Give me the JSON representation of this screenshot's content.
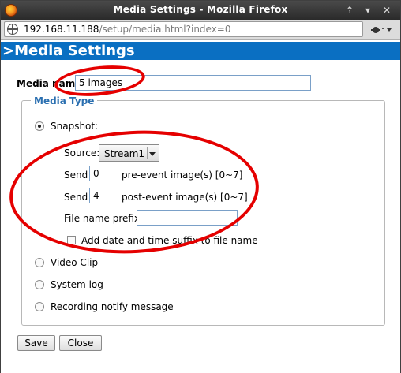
{
  "window": {
    "title": "Media Settings - Mozilla Firefox",
    "controls": {
      "pin": "⇡",
      "minimize": "▾",
      "close": "✕"
    }
  },
  "urlbar": {
    "host": "192.168.11.188",
    "path": "/setup/media.html?index=0"
  },
  "page": {
    "header": ">Media Settings",
    "media_name": {
      "label": "Media name:",
      "value": "5 images"
    },
    "media_type": {
      "legend": "Media Type",
      "options": {
        "snapshot": "Snapshot:",
        "video_clip": "Video Clip",
        "system_log": "System log",
        "recording_notify": "Recording notify message"
      },
      "selected": "snapshot"
    },
    "snapshot": {
      "source_label": "Source:",
      "source_value": "Stream1",
      "send_label": "Send",
      "pre_event_value": "0",
      "pre_event_label": "pre-event image(s) [0~7]",
      "post_event_value": "4",
      "post_event_label": "post-event image(s) [0~7]",
      "file_prefix_label": "File name prefix:",
      "file_prefix_value": "",
      "suffix_checkbox_label": "Add date and time suffix to file name",
      "suffix_checked": false
    },
    "buttons": {
      "save": "Save",
      "close": "Close"
    }
  },
  "colors": {
    "header_bg": "#0a6fc2",
    "legend_text": "#2a6fb0",
    "annotation": "#e50000"
  }
}
